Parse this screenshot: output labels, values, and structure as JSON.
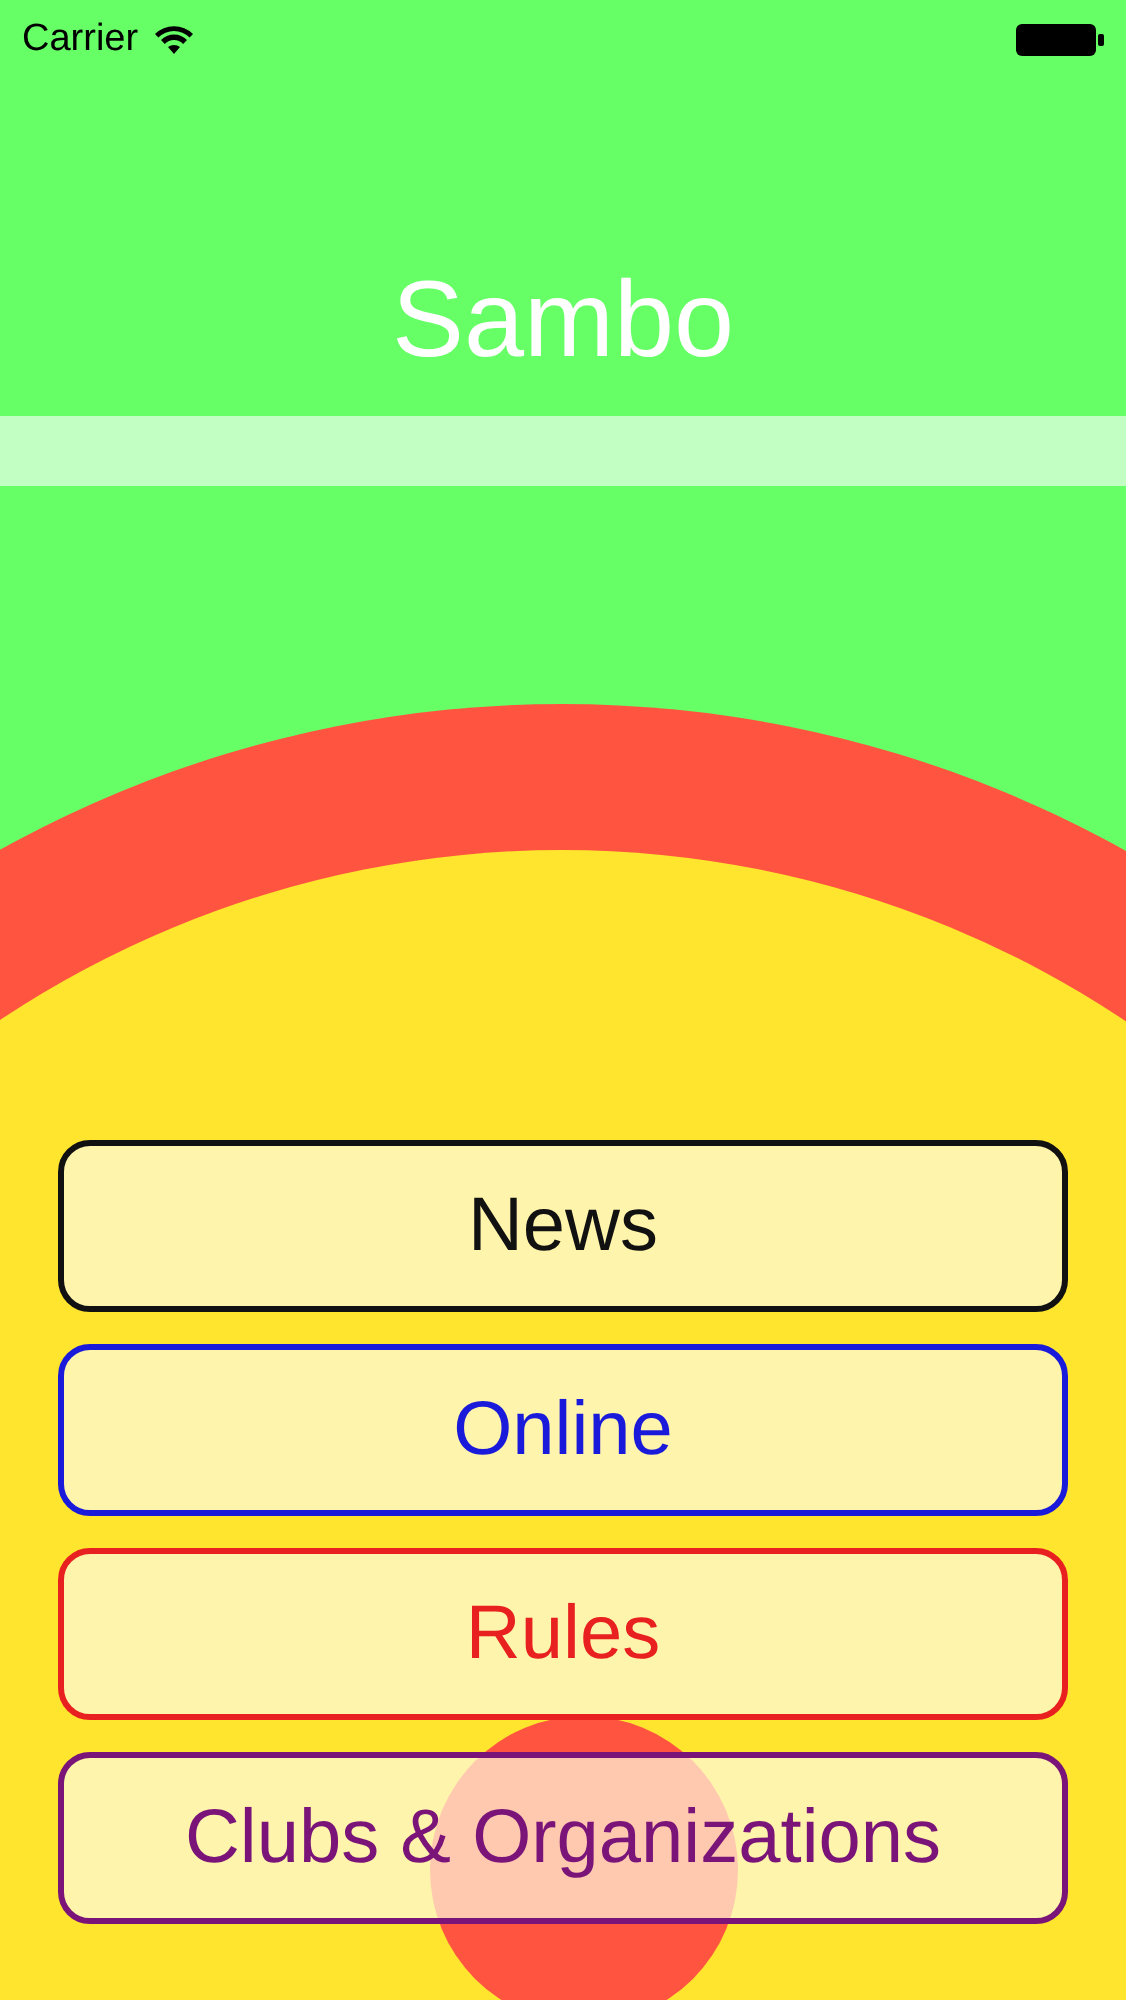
{
  "status_bar": {
    "carrier": "Carrier"
  },
  "title": "Sambo",
  "menu": [
    {
      "label": "News",
      "color": "#111111"
    },
    {
      "label": "Online",
      "color": "#1a1adb"
    },
    {
      "label": "Rules",
      "color": "#e82020"
    },
    {
      "label": "Clubs & Organizations",
      "color": "#7a1478"
    }
  ]
}
